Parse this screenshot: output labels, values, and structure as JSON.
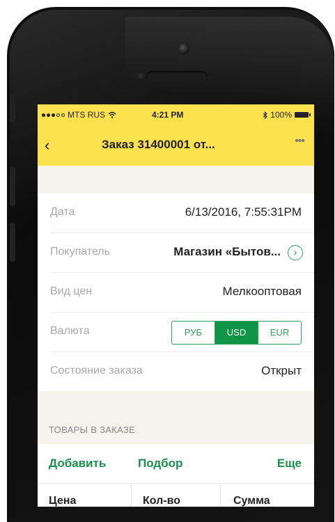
{
  "status_bar": {
    "carrier": "MTS RUS",
    "time": "4:21 PM",
    "battery": "100%"
  },
  "nav": {
    "title": "Заказ 31400001 от...",
    "back_icon": "chevron-left-icon",
    "more_icon": "more-icon"
  },
  "form": {
    "date": {
      "label": "Дата",
      "value": "6/13/2016, 7:55:31PM"
    },
    "buyer": {
      "label": "Покупатель",
      "value": "Магазин «Бытов..."
    },
    "price_type": {
      "label": "Вид цен",
      "value": "Мелкооптовая"
    },
    "currency": {
      "label": "Валюта",
      "options": [
        "РУБ",
        "USD",
        "EUR"
      ],
      "selected": "USD"
    },
    "status": {
      "label": "Состояние заказа",
      "value": "Открыт"
    }
  },
  "goods": {
    "section_label": "ТОВАРЫ В ЗАКАЗЕ",
    "actions": {
      "add": "Добавить",
      "pick": "Подбор",
      "more": "Еще"
    },
    "columns": [
      "Цена",
      "Кол-во",
      "Сумма"
    ]
  },
  "colors": {
    "header_yellow": "#fce14f",
    "accent_green": "#109446"
  }
}
